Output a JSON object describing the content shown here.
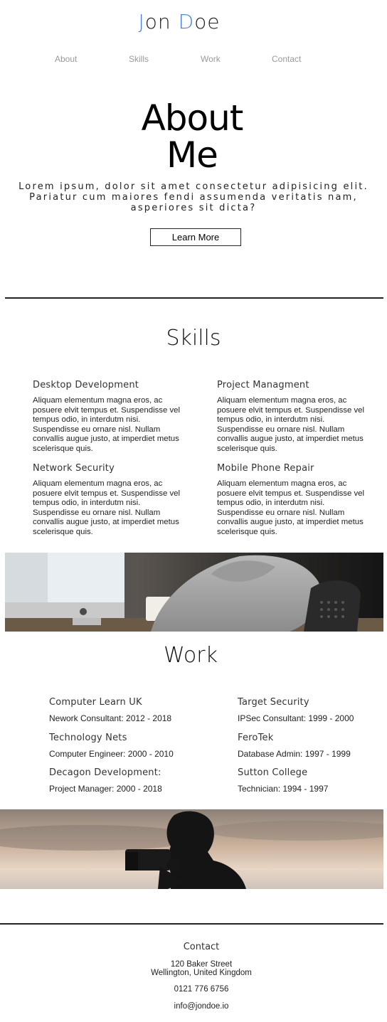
{
  "header": {
    "brand_first_initial": "J",
    "brand_first_rest": "on ",
    "brand_last_initial": "D",
    "brand_last_rest": "oe",
    "accent_color": "#4a7fe0"
  },
  "nav": {
    "items": [
      {
        "label": "About"
      },
      {
        "label": "Skills"
      },
      {
        "label": "Work"
      },
      {
        "label": "Contact"
      }
    ]
  },
  "about": {
    "title_line1": "About",
    "title_line2": "Me",
    "text": "Lorem ipsum, dolor sit amet consectetur adipisicing elit. Pariatur cum maiores fendi assumenda veritatis nam, asperiores sit dicta?",
    "button_label": "Learn More"
  },
  "skills": {
    "title": "Skills",
    "items": [
      {
        "heading": "Desktop Development",
        "text": "Aliquam elementum magna eros, ac posuere elvit tempus et. Suspendisse vel tempus odio, in interdutm nisi. Suspendisse eu ornare nisl. Nullam convallis augue justo, at imperdiet metus scelerisque quis."
      },
      {
        "heading": "Project Managment",
        "text": "Aliquam elementum magna eros, ac posuere elvit tempus et. Suspendisse vel tempus odio, in interdutm nisi. Suspendisse eu ornare nisl. Nullam convallis augue justo, at imperdiet metus scelerisque quis."
      },
      {
        "heading": "Network Security",
        "text": "Aliquam elementum magna eros, ac posuere elvit tempus et. Suspendisse vel tempus odio, in interdutm nisi. Suspendisse eu ornare nisl. Nullam convallis augue justo, at imperdiet metus scelerisque quis."
      },
      {
        "heading": "Mobile Phone Repair",
        "text": "Aliquam elementum magna eros, ac posuere elvit tempus et. Suspendisse vel tempus odio, in interdutm nisi. Suspendisse eu ornare nisl. Nullam convallis augue justo, at imperdiet metus scelerisque quis."
      }
    ]
  },
  "work": {
    "title": "Work",
    "items": [
      {
        "company": "Computer Learn UK",
        "role": "Nework Consultant: 2012 - 2018"
      },
      {
        "company": "Target Security",
        "role": "IPSec Consultant: 1999 - 2000"
      },
      {
        "company": "Technology Nets",
        "role": "Computer Engineer: 2000 - 2010"
      },
      {
        "company": "FeroTek",
        "role": "Database Admin: 1997 - 1999"
      },
      {
        "company": "Decagon Development:",
        "role": "Project Manager: 2000 - 2018"
      },
      {
        "company": "Sutton College",
        "role": "Technician: 1994 - 1997"
      }
    ]
  },
  "contact": {
    "title": "Contact",
    "address_line1": "120 Baker Street",
    "address_line2": "Wellington, United Kingdom",
    "phone": "0121 776 6756",
    "email": "info@jondoe.io"
  }
}
